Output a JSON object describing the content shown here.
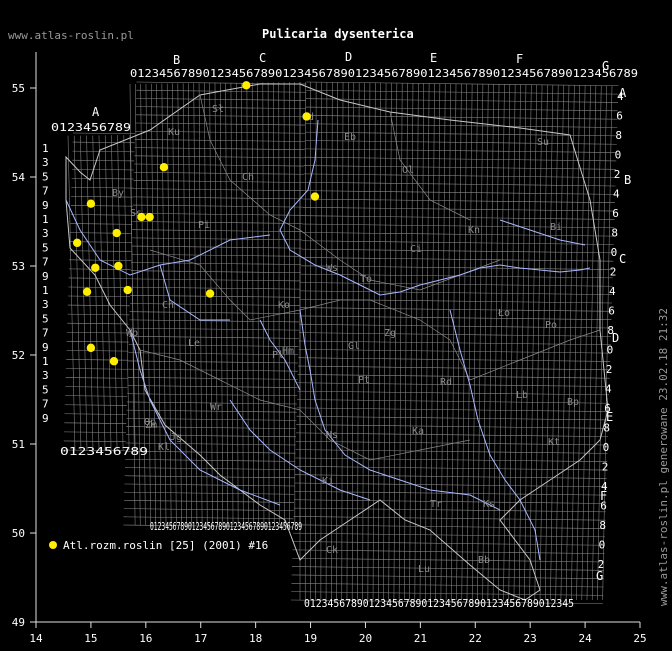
{
  "header": {
    "site": "www.atlas-roslin.pl",
    "title": "Pulicaria dysenterica",
    "vertical_note": "www.atlas-roslin.pl generowane 23.02.18 21:32"
  },
  "axes": {
    "x_ticks": [
      "14",
      "15",
      "16",
      "17",
      "18",
      "19",
      "20",
      "21",
      "22",
      "23",
      "24",
      "25"
    ],
    "y_ticks": [
      "55",
      "54",
      "53",
      "52",
      "51",
      "50",
      "49"
    ]
  },
  "grid": {
    "column_letters": [
      "A",
      "B",
      "C",
      "D",
      "E",
      "F",
      "G"
    ],
    "row_letters": [
      "A",
      "B",
      "C",
      "D",
      "E",
      "F",
      "G"
    ],
    "top_digits": "0123456789012345678901234567890123456789012345678901234567890123456789",
    "left_digits": [
      "1",
      "3",
      "5",
      "7",
      "9",
      "1",
      "3",
      "5",
      "7",
      "9",
      "1",
      "3",
      "5",
      "7",
      "9",
      "1",
      "3",
      "5",
      "7",
      "9"
    ],
    "right_digits": [
      "4",
      "6",
      "8",
      "0",
      "2",
      "4",
      "6",
      "8",
      "0",
      "2",
      "4",
      "6",
      "8",
      "0",
      "2",
      "4",
      "6",
      "8",
      "0",
      "2",
      "4",
      "6",
      "8",
      "0",
      "2"
    ],
    "bottom_digits_g": "0123456789012345678901234567890123456789012345",
    "bottom_digits_left": "0123456789",
    "bottom_digits_mid": "0123456789012345678901234567890123456789"
  },
  "regions": [
    "Sł",
    "Ku",
    "Eb",
    "Ol",
    "Su",
    "Ch",
    "Pi",
    "By",
    "Gd",
    "Ci",
    "Bi",
    "Ko",
    "Ws",
    "To",
    "Ss",
    "Kn",
    "Ło",
    "Le",
    "Kl",
    "Pt",
    "Rd",
    "Lb",
    "Wr",
    "Op",
    "Ka",
    "Ki",
    "Tr",
    "Ks",
    "Kt",
    "Zm",
    "Jg",
    "Wb",
    "Zg",
    "Po",
    "Lu",
    "Pl",
    "Bp",
    "Ns",
    "Ch2",
    "Ck",
    "Gl",
    "Bb",
    "Hm"
  ],
  "legend": {
    "marker_color": "#ffee00",
    "label": "Atl.rozm.roslin [25] (2001) #16"
  },
  "records": [
    {
      "lon": 17.83,
      "lat": 55.03
    },
    {
      "lon": 18.93,
      "lat": 54.68
    },
    {
      "lon": 16.33,
      "lat": 54.11
    },
    {
      "lon": 15.0,
      "lat": 53.7
    },
    {
      "lon": 19.08,
      "lat": 53.78
    },
    {
      "lon": 15.92,
      "lat": 53.55
    },
    {
      "lon": 16.07,
      "lat": 53.55
    },
    {
      "lon": 15.47,
      "lat": 53.37
    },
    {
      "lon": 14.75,
      "lat": 53.26
    },
    {
      "lon": 15.08,
      "lat": 52.98
    },
    {
      "lon": 15.5,
      "lat": 53.0
    },
    {
      "lon": 14.93,
      "lat": 52.71
    },
    {
      "lon": 15.67,
      "lat": 52.73
    },
    {
      "lon": 17.17,
      "lat": 52.69
    },
    {
      "lon": 15.0,
      "lat": 52.08
    },
    {
      "lon": 15.42,
      "lat": 51.93
    }
  ]
}
